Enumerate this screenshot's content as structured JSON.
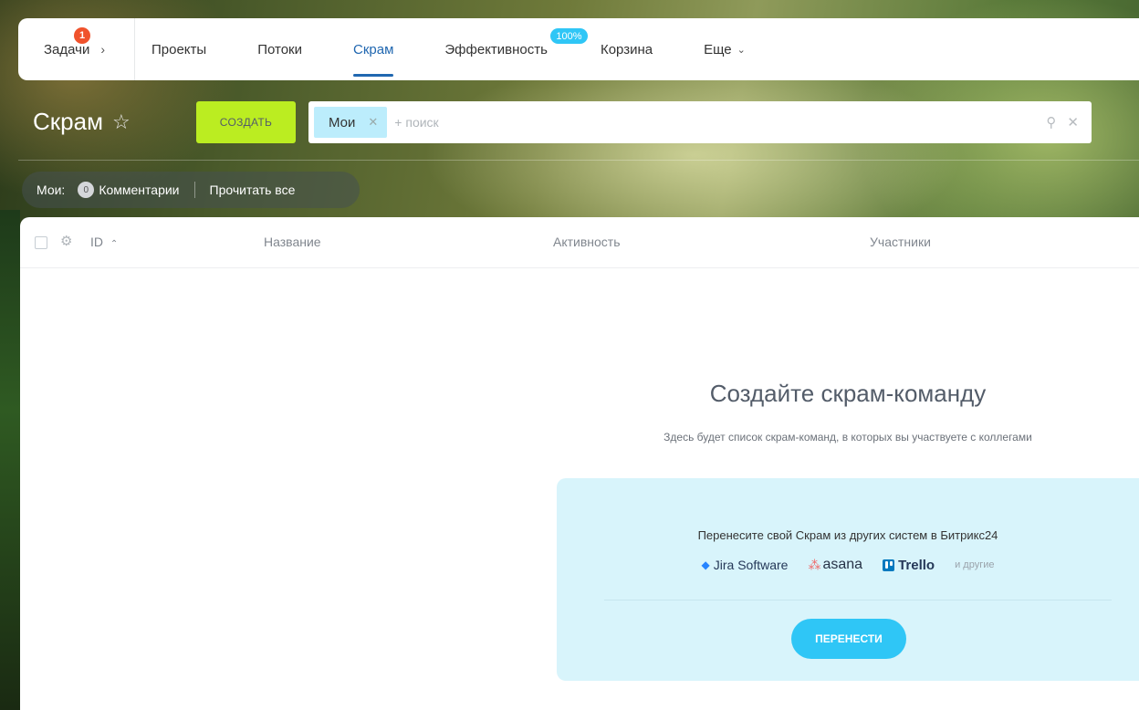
{
  "nav": {
    "tasks_label": "Задачи",
    "tasks_badge": "1",
    "items": [
      {
        "label": "Проекты"
      },
      {
        "label": "Потоки"
      },
      {
        "label": "Скрам"
      },
      {
        "label": "Эффективность",
        "badge": "100%"
      },
      {
        "label": "Корзина"
      },
      {
        "label": "Еще"
      }
    ],
    "active": "Скрам"
  },
  "header": {
    "title": "Скрам",
    "create_label": "создать",
    "filter_chip": "Мои",
    "search_placeholder": "+ поиск"
  },
  "counters": {
    "prefix": "Мои:",
    "count": "0",
    "count_label": "Комментарии",
    "read_all": "Прочитать все"
  },
  "grid": {
    "columns": [
      "ID",
      "Название",
      "Активность",
      "Участники"
    ]
  },
  "empty": {
    "title": "Создайте скрам-команду",
    "subtitle": "Здесь будет список скрам-команд, в которых вы участвуете с коллегами"
  },
  "migrate": {
    "text": "Перенесите свой Скрам из других систем в Битрикс24",
    "logos": [
      "Jira Software",
      "asana",
      "Trello"
    ],
    "others": "и другие",
    "button": "перенести"
  },
  "colors": {
    "accent": "#2067b0",
    "create_btn": "#bbed21",
    "migrate_btn": "#2fc6f6",
    "chip": "#bcedfc",
    "badge": "#f0522c"
  }
}
